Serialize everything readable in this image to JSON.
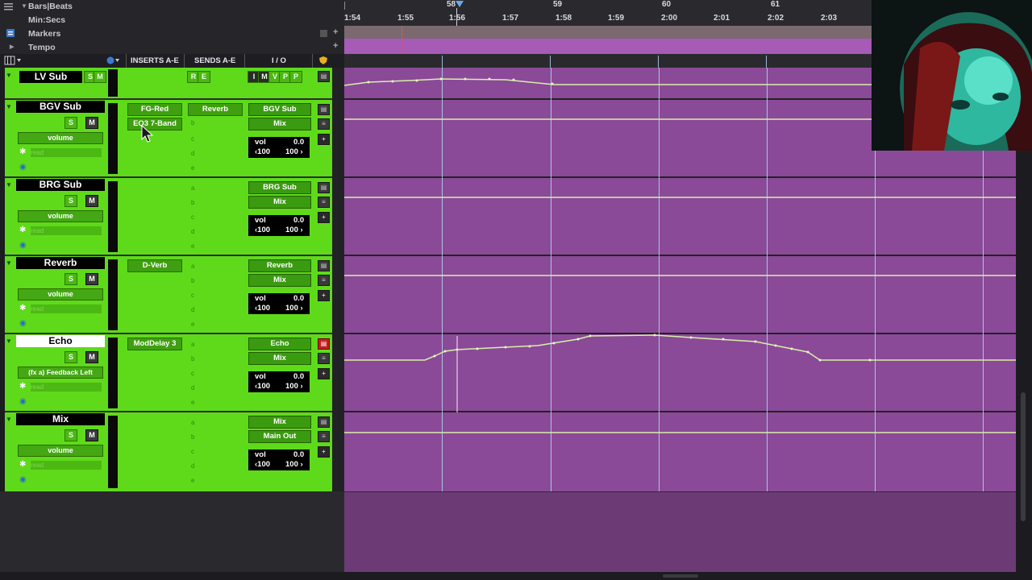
{
  "rulers": {
    "rows": [
      "Bars|Beats",
      "Min:Secs",
      "Markers",
      "Tempo"
    ],
    "bar_labels": [
      "58",
      "59",
      "60",
      "61"
    ],
    "time_labels": [
      "1:54",
      "1:55",
      "1:56",
      "1:57",
      "1:58",
      "1:59",
      "2:00",
      "2:01",
      "2:02",
      "2:03"
    ]
  },
  "header": {
    "inserts": "INSERTS A-E",
    "sends": "SENDS A-E",
    "io": "I / O"
  },
  "tracks": [
    {
      "name": "LV Sub",
      "s": "S",
      "m": "M",
      "rec": "R",
      "edit": "E",
      "i": "I",
      "mm": "M",
      "v": "V",
      "p1": "P",
      "p2": "P"
    },
    {
      "name": "BGV Sub",
      "s": "S",
      "m": "M",
      "auto": "volume",
      "dyn": "dyn",
      "read": "read",
      "insert_a": "FG-Red",
      "insert_b": "EQ3 7-Band",
      "send_a": "Reverb",
      "send_letters": [
        "b",
        "c",
        "d",
        "e"
      ],
      "output": "BGV Sub",
      "input": "Mix",
      "vol_label": "vol",
      "vol_value": "0.0",
      "pan_l": "‹100",
      "pan_r": "100 ›"
    },
    {
      "name": "BRG Sub",
      "s": "S",
      "m": "M",
      "auto": "volume",
      "dyn": "dyn",
      "read": "read",
      "send_letters": [
        "a",
        "b",
        "c",
        "d",
        "e"
      ],
      "output": "BRG Sub",
      "input": "Mix",
      "vol_label": "vol",
      "vol_value": "0.0",
      "pan_l": "‹100",
      "pan_r": "100 ›"
    },
    {
      "name": "Reverb",
      "s": "S",
      "m": "M",
      "auto": "volume",
      "dyn": "dyn",
      "read": "read",
      "insert_a": "D-Verb",
      "send_letters": [
        "a",
        "b",
        "c",
        "d",
        "e"
      ],
      "output": "Reverb",
      "input": "Mix",
      "vol_label": "vol",
      "vol_value": "0.0",
      "pan_l": "‹100",
      "pan_r": "100 ›"
    },
    {
      "name": "Echo",
      "s": "S",
      "m": "M",
      "auto": "(fx a) Feedback Left",
      "dyn": "dyn",
      "read": "read",
      "insert_a": "ModDelay 3",
      "send_letters": [
        "a",
        "b",
        "c",
        "d",
        "e"
      ],
      "output": "Echo",
      "input": "Mix",
      "vol_label": "vol",
      "vol_value": "0.0",
      "pan_l": "‹100",
      "pan_r": "100 ›"
    },
    {
      "name": "Mix",
      "s": "S",
      "m": "M",
      "auto": "volume",
      "dyn": "dyn",
      "read": "read",
      "send_letters": [
        "a",
        "b",
        "c",
        "d",
        "e"
      ],
      "output": "Main Out",
      "input": "Mix",
      "vol_label": "vol",
      "vol_value": "0.0",
      "pan_l": "‹100",
      "pan_r": "100 ›"
    }
  ],
  "colors": {
    "track_green": "#5eda1a",
    "lane_purple": "#8a4a98",
    "grid_blue": "#b4d8f0",
    "automation": "#cde8a0"
  }
}
